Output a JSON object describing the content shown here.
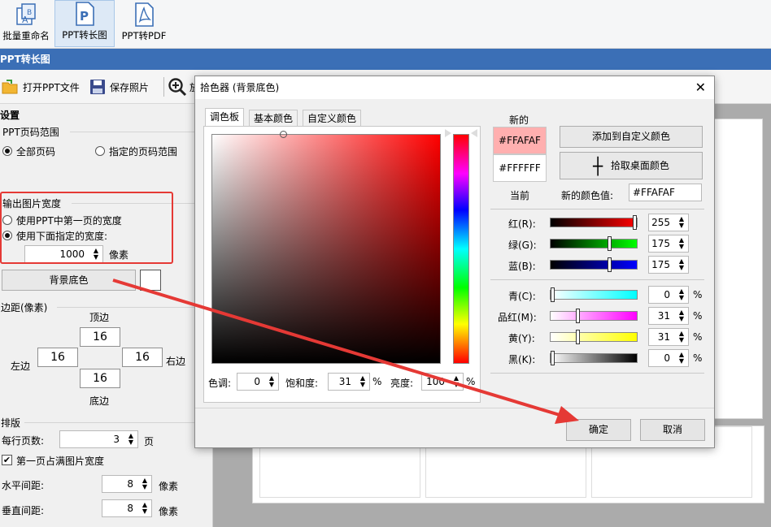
{
  "ribbon": {
    "buttons": [
      {
        "label": "批量重命名"
      },
      {
        "label": "PPT转长图"
      },
      {
        "label": "PPT转PDF"
      }
    ]
  },
  "titlebar": {
    "title": "PPT转长图"
  },
  "toolbar": {
    "open_label": "打开PPT文件",
    "save_label": "保存照片",
    "zoom_suffix": "放"
  },
  "settings": {
    "header": "设置",
    "page_range": {
      "title": "PPT页码范围",
      "all": "全部页码",
      "specified": "指定的页码范围"
    },
    "width": {
      "title": "输出图片宽度",
      "opt_first": "使用PPT中第一页的宽度",
      "opt_custom": "使用下面指定的宽度:",
      "value": "1000",
      "unit": "像素"
    },
    "bg_button": "背景底色",
    "margins": {
      "title": "边距(像素)",
      "top_label": "顶边",
      "top": "16",
      "left_label": "左边",
      "left": "16",
      "right": "16",
      "right_label": "右边",
      "bottom": "16",
      "bottom_label": "底边"
    },
    "layout": {
      "title": "排版",
      "per_row_label": "每行页数:",
      "per_row": "3",
      "per_row_unit": "页",
      "first_full": "第一页占满图片宽度",
      "h_gap_label": "水平间距:",
      "h_gap": "8",
      "h_gap_unit": "像素",
      "v_gap_label": "垂直间距:",
      "v_gap": "8",
      "v_gap_unit": "像素"
    }
  },
  "dialog": {
    "title": "拾色器 (背景底色)",
    "tabs": [
      "调色板",
      "基本颜色",
      "自定义颜色"
    ],
    "new_label": "新的",
    "current_label": "当前",
    "new_color": "#FFAFAF",
    "current_color": "#FFFFFF",
    "add_custom": "添加到自定义颜色",
    "pick_desktop": "拾取桌面颜色",
    "new_value_label": "新的颜色值:",
    "new_value": "#FFAFAF",
    "rgb": [
      {
        "label": "红(R):",
        "value": "255"
      },
      {
        "label": "绿(G):",
        "value": "175"
      },
      {
        "label": "蓝(B):",
        "value": "175"
      }
    ],
    "cmyk": [
      {
        "label": "青(C):",
        "value": "0",
        "unit": "%"
      },
      {
        "label": "品红(M):",
        "value": "31",
        "unit": "%"
      },
      {
        "label": "黄(Y):",
        "value": "31",
        "unit": "%"
      },
      {
        "label": "黑(K):",
        "value": "0",
        "unit": "%"
      }
    ],
    "hsv": {
      "hue_label": "色调:",
      "hue": "0",
      "sat_label": "饱和度:",
      "sat": "31",
      "sat_unit": "%",
      "val_label": "亮度:",
      "val": "100",
      "val_unit": "%"
    },
    "ok": "确定",
    "cancel": "取消"
  },
  "colors": {
    "accent": "#3b6fb6",
    "annotation": "#e53935"
  }
}
